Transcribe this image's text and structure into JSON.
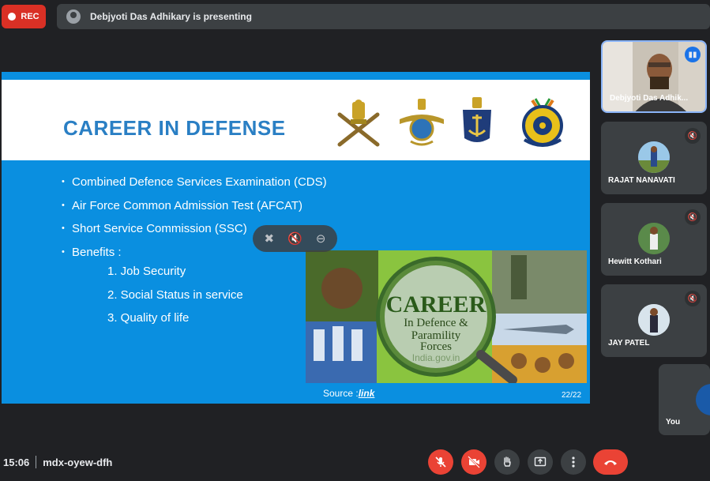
{
  "topbar": {
    "rec_label": "REC",
    "presenting_text": "Debjyoti Das Adhikary is presenting"
  },
  "slide": {
    "title": "CAREER IN DEFENSE",
    "bullets": [
      "Combined Defence Services Examination (CDS)",
      "Air Force Common Admission Test (AFCAT)",
      "Short Service Commission (SSC)",
      "Benefits :"
    ],
    "benefits": [
      "1. Job Security",
      "2. Social Status in service",
      "3. Quality of life"
    ],
    "image_text": {
      "line1": "CAREER",
      "line2": "In Defence &",
      "line3": "Paramility",
      "line4": "Forces",
      "watermark": "India.gov.in"
    },
    "source_label": "Source :",
    "source_link": "link",
    "page": "22/22"
  },
  "participants": [
    {
      "name": "Debjyoti Das Adhik...",
      "status": "speaking"
    },
    {
      "name": "RAJAT NANAVATI",
      "status": "muted"
    },
    {
      "name": "Hewitt Kothari",
      "status": "muted"
    },
    {
      "name": "JAY PATEL",
      "status": "muted"
    },
    {
      "name": "You",
      "status": "self"
    }
  ],
  "bottombar": {
    "time": "15:06",
    "meeting_code": "mdx-oyew-dfh"
  },
  "colors": {
    "accent_red": "#ea4335",
    "slide_blue": "#0a8fe0",
    "title_blue": "#2a7fc4",
    "tile_bg": "#3c4043",
    "page_bg": "#202124"
  }
}
